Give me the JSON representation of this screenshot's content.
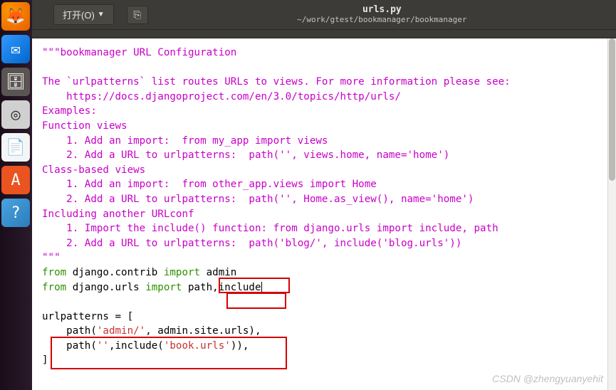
{
  "dock": {
    "icons": [
      "firefox",
      "thunderbird",
      "files",
      "rhythmbox",
      "libreoffice-writer",
      "ubuntu-software",
      "help"
    ]
  },
  "titlebar": {
    "open_label": "打开(O)",
    "filename": "urls.py",
    "filepath": "~/work/gtest/bookmanager/bookmanager"
  },
  "code": {
    "line01": "\"\"\"bookmanager URL Configuration",
    "line02": "",
    "line03": "The `urlpatterns` list routes URLs to views. For more information please see:",
    "line04": "    https://docs.djangoproject.com/en/3.0/topics/http/urls/",
    "line05": "Examples:",
    "line06": "Function views",
    "line07": "    1. Add an import:  from my_app import views",
    "line08": "    2. Add a URL to urlpatterns:  path('', views.home, name='home')",
    "line09": "Class-based views",
    "line10": "    1. Add an import:  from other_app.views import Home",
    "line11": "    2. Add a URL to urlpatterns:  path('', Home.as_view(), name='home')",
    "line12": "Including another URLconf",
    "line13": "    1. Import the include() function: from django.urls import include, path",
    "line14": "    2. Add a URL to urlpatterns:  path('blog/', include('blog.urls'))",
    "line15": "\"\"\"",
    "l16_from": "from",
    "l16_mod": " django.contrib ",
    "l16_import": "import",
    "l16_rest": " admin",
    "l17_from": "from",
    "l17_mod": " django.urls ",
    "l17_import": "import",
    "l17_rest1": " path,",
    "l17_rest2": "include",
    "line18": "",
    "l19_a": "urlpatterns = [",
    "l20_indent": "    path(",
    "l20_str": "'admin/'",
    "l20_rest": ", admin.site.urls),",
    "l21_indent": "    path(",
    "l21_str1": "''",
    "l21_mid": ",include(",
    "l21_str2": "'book.urls'",
    "l21_end": ")),",
    "l22": "]"
  },
  "watermark_text": "CSDN @zhengyuanyehit"
}
